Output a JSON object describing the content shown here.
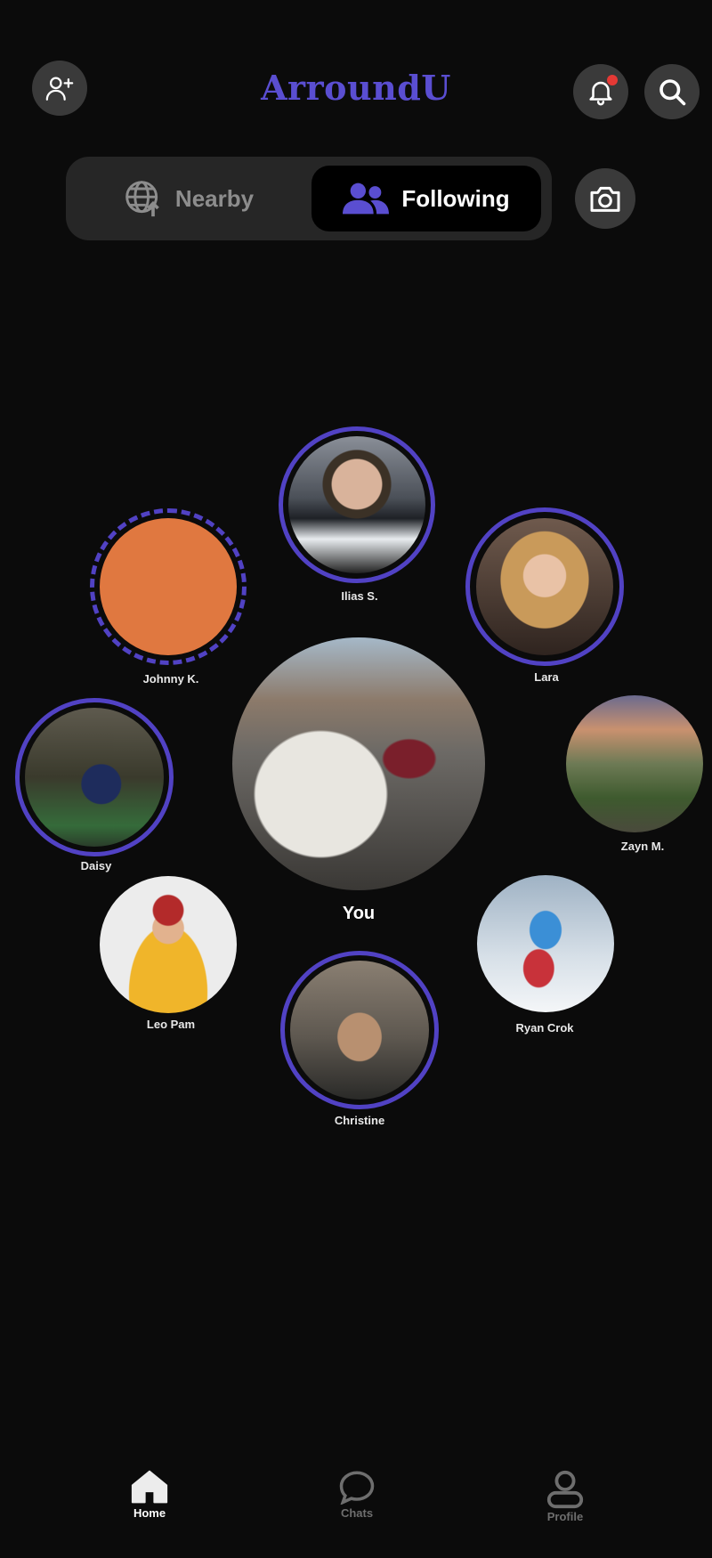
{
  "app": {
    "title": "ArroundU"
  },
  "header": {
    "add_friend_icon": "person-plus-icon",
    "notifications_icon": "bell-icon",
    "notification_badge_color": "#e53935",
    "search_icon": "search-icon"
  },
  "tabs": {
    "nearby": {
      "label": "Nearby",
      "icon": "globe-upload-icon",
      "active": false
    },
    "following": {
      "label": "Following",
      "icon": "people-icon",
      "active": true
    }
  },
  "camera": {
    "icon": "camera-icon"
  },
  "colors": {
    "accent": "#5a4ed1",
    "ring": "#5142c4",
    "background": "#0b0b0b",
    "surface": "#262626",
    "placeholder_avatar": "#e07840"
  },
  "people": [
    {
      "name": "Ilias S."
    },
    {
      "name": "Johnny K."
    },
    {
      "name": "Lara"
    },
    {
      "name": "Daisy"
    },
    {
      "name": "Zayn M."
    },
    {
      "name": "Leo Pam"
    },
    {
      "name": "Ryan Crok"
    },
    {
      "name": "Christine"
    }
  ],
  "me": {
    "label": "You"
  },
  "nav": {
    "home": {
      "label": "Home",
      "icon": "home-icon",
      "active": true
    },
    "chats": {
      "label": "Chats",
      "icon": "chat-bubble-icon",
      "active": false
    },
    "profile": {
      "label": "Profile",
      "icon": "profile-icon",
      "active": false
    }
  }
}
